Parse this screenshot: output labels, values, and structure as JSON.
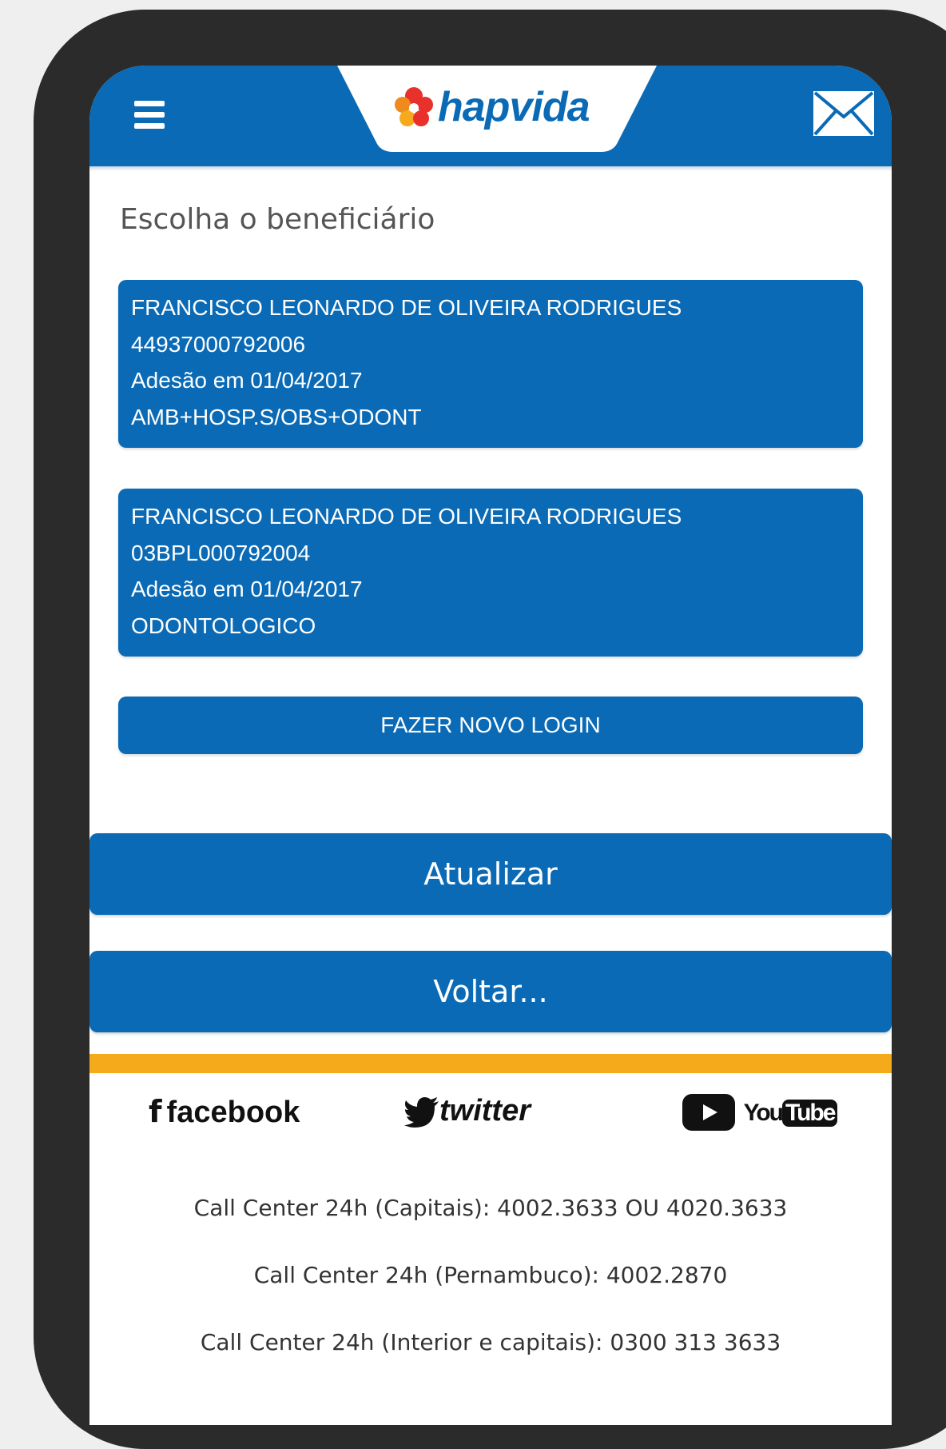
{
  "header": {
    "brand": "hapvida",
    "menu_icon": "hamburger-menu-icon",
    "mail_icon": "mail-icon"
  },
  "page": {
    "title": "Escolha o beneficiário"
  },
  "beneficiaries": [
    {
      "name": "FRANCISCO LEONARDO DE OLIVEIRA RODRIGUES",
      "card_number": "44937000792006",
      "adhesion": "Adesão em 01/04/2017",
      "plan": "AMB+HOSP.S/OBS+ODONT"
    },
    {
      "name": "FRANCISCO LEONARDO DE OLIVEIRA RODRIGUES",
      "card_number": "03BPL000792004",
      "adhesion": "Adesão em 01/04/2017",
      "plan": "ODONTOLOGICO"
    }
  ],
  "actions": {
    "new_login": "FAZER NOVO LOGIN",
    "refresh": "Atualizar",
    "back": "Voltar..."
  },
  "footer": {
    "social": {
      "facebook": "facebook",
      "twitter": "twitter",
      "youtube_you": "You",
      "youtube_tube": "Tube"
    },
    "call_center": [
      "Call Center 24h (Capitais): 4002.3633 OU 4020.3633",
      "Call Center 24h (Pernambuco): 4002.2870",
      "Call Center 24h (Interior e capitais): 0300 313 3633"
    ]
  },
  "colors": {
    "brand_blue": "#0a6ab5",
    "accent_yellow": "#f5aa1c",
    "device_frame": "#2b2b2b"
  }
}
